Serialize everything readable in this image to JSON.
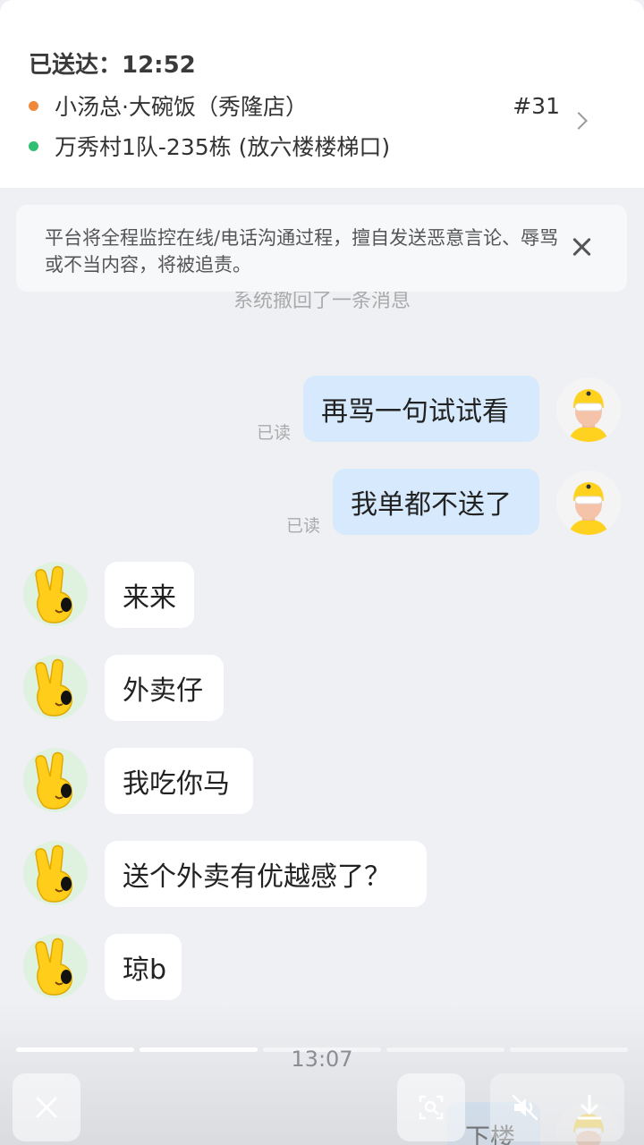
{
  "order": {
    "status": "已送达：12:52",
    "shop": "小汤总·大碗饭（秀隆店）",
    "order_no": "#31",
    "destination": "万秀村1队-235栋 (放六楼楼梯口)"
  },
  "notice": {
    "text": "平台将全程监控在线/电话沟通过程，擅自发送恶意言论、辱骂或不当内容，将被追责。"
  },
  "system": {
    "recall": "系统撤回了一条消息"
  },
  "messages": [
    {
      "from": "rider",
      "text": "再骂一句试试看",
      "status": "已读"
    },
    {
      "from": "rider",
      "text": "我单都不送了",
      "status": "已读"
    },
    {
      "from": "customer",
      "text": "来来"
    },
    {
      "from": "customer",
      "text": "外卖仔"
    },
    {
      "from": "customer",
      "text": "我吃你马"
    },
    {
      "from": "customer",
      "text": "送个外卖有优越感了？"
    },
    {
      "from": "customer",
      "text": "琼b"
    },
    {
      "from": "rider",
      "text": "下楼"
    }
  ],
  "player": {
    "time": "13:07",
    "segments_total": 5,
    "segments_done": 2
  },
  "colors": {
    "outgoing_bubble": "#d7e9fc",
    "incoming_bubble": "#ffffff",
    "shop_dot": "#f08a3a",
    "destination_dot": "#2fbf71",
    "rider_helmet": "#ffd21f"
  },
  "icons": {
    "close": "close-icon",
    "scan": "scan-icon",
    "mute": "speaker-muted-icon",
    "download": "download-icon",
    "chevron": "chevron-right-icon"
  }
}
